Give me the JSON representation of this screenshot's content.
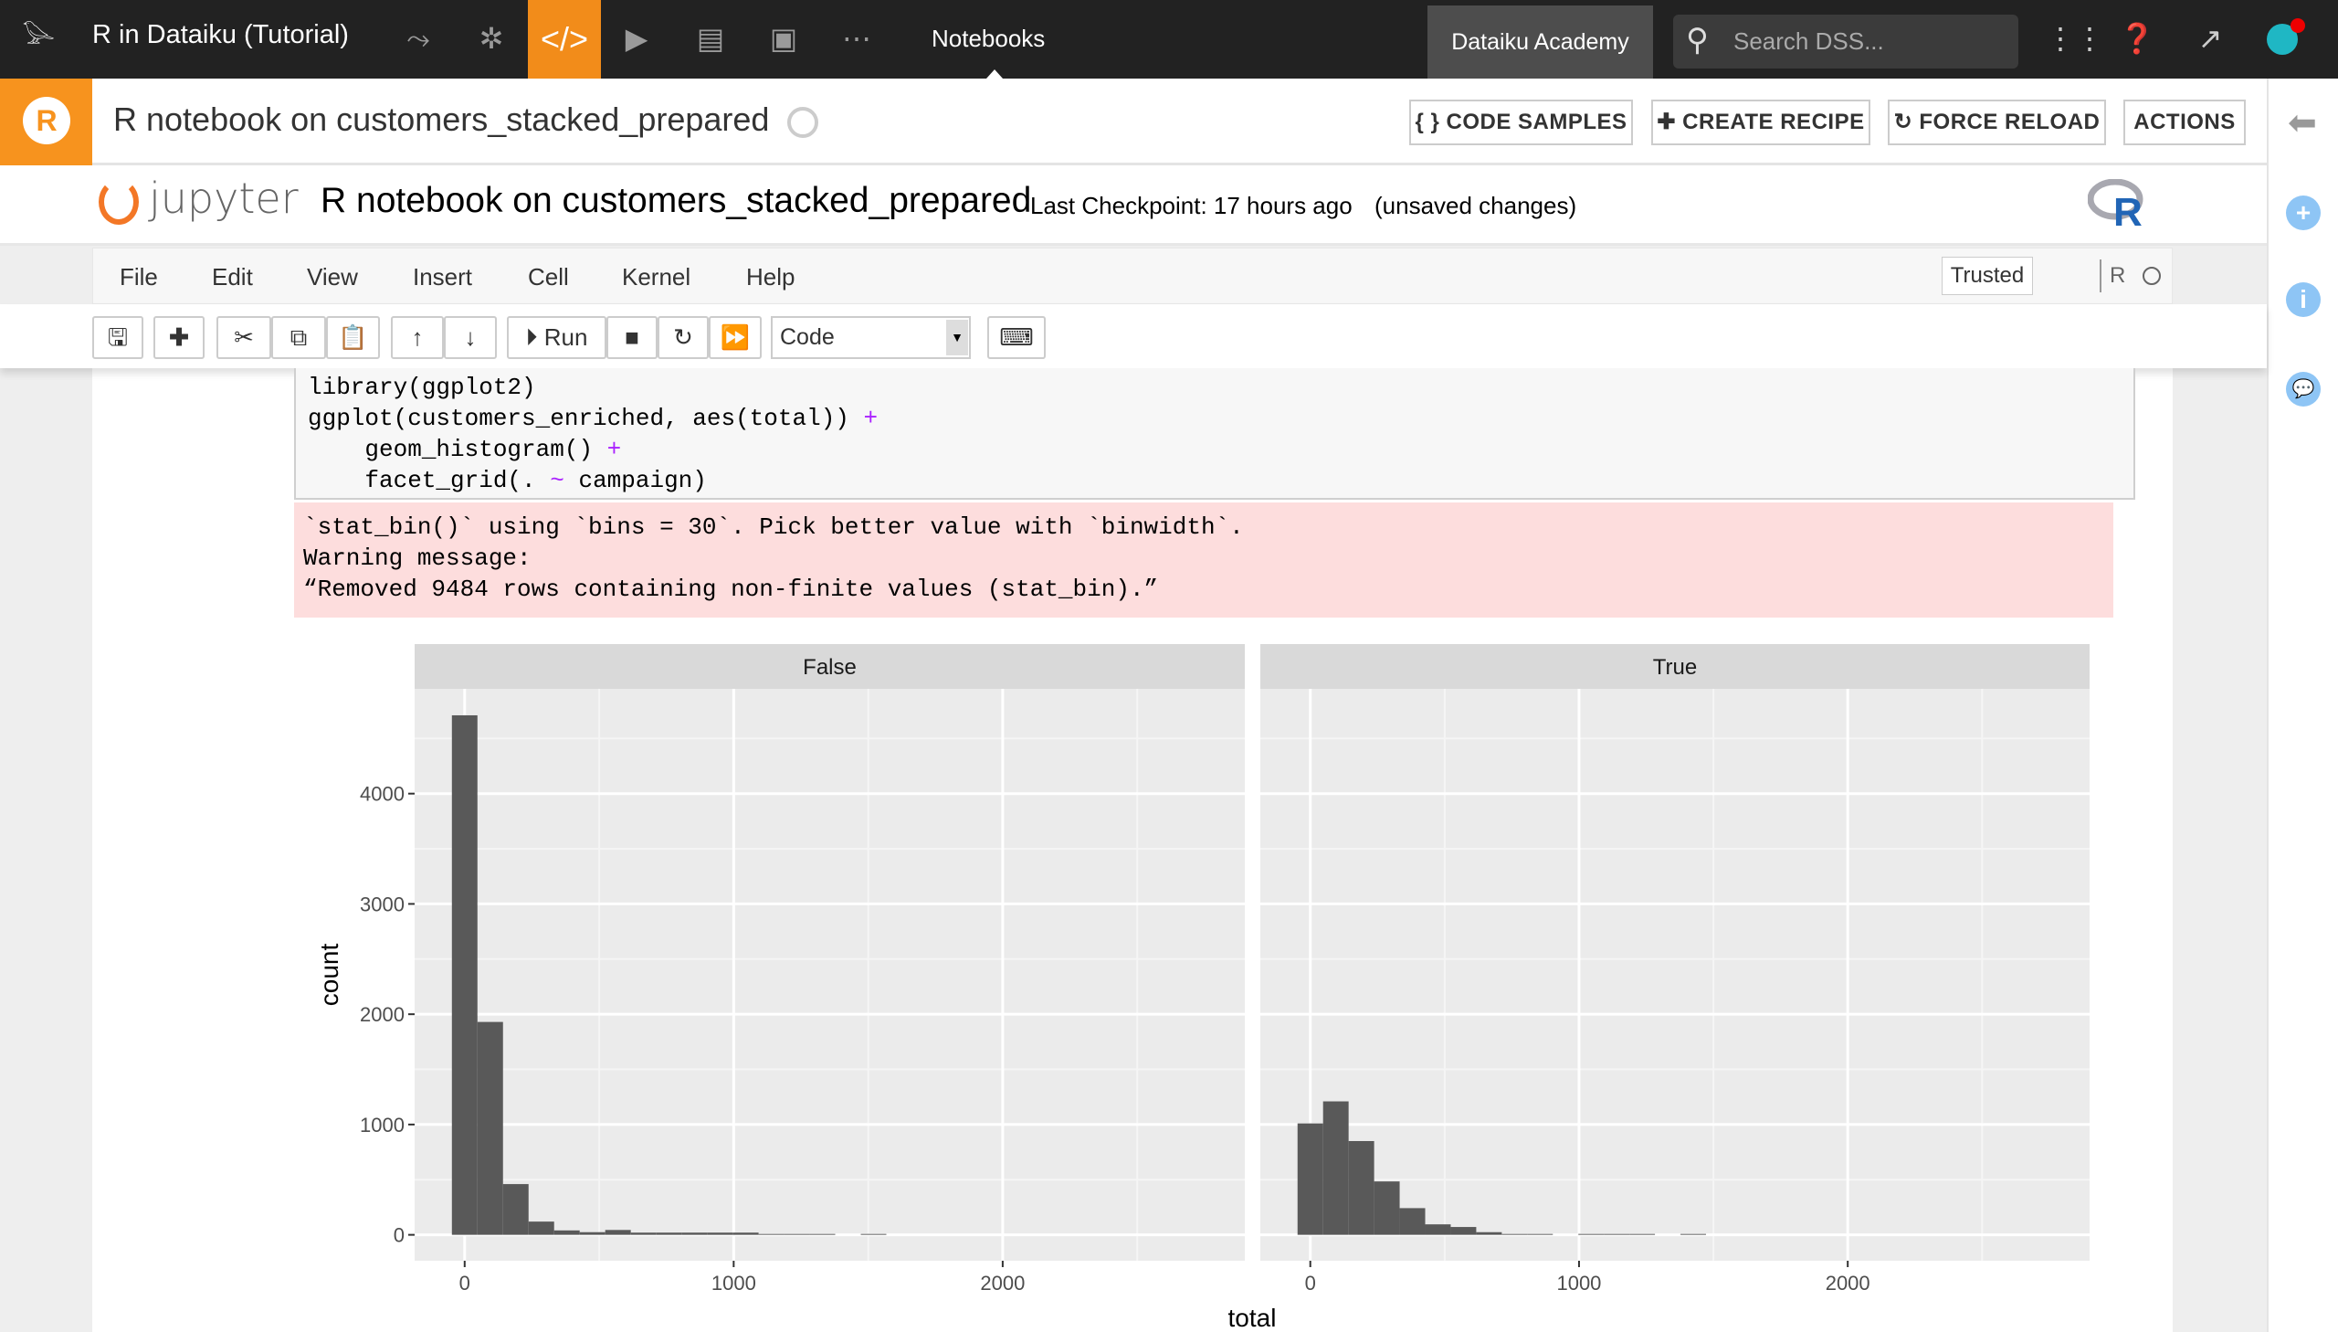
{
  "topbar": {
    "app_title": "R in Dataiku (Tutorial)",
    "icons": [
      "dataiku-bird-logo-icon",
      "flow-icon",
      "lab-icon",
      "code-icon",
      "run-icon",
      "deploy-icon",
      "dashboard-icon",
      "more-icon"
    ],
    "notebooks_label": "Notebooks",
    "academy_label": "Dataiku Academy",
    "search_placeholder": "Search DSS...",
    "right_icons": [
      "apps-grid-icon",
      "help-icon",
      "activity-icon",
      "avatar"
    ]
  },
  "header": {
    "title": "R notebook on customers_stacked_prepared",
    "buttons": {
      "code_samples": "{ }  CODE SAMPLES",
      "create_recipe": "✚ CREATE RECIPE",
      "force_reload": "↻ FORCE RELOAD",
      "actions": "ACTIONS"
    }
  },
  "jupyter": {
    "logo_text": "jupyter",
    "notebook_name": "R notebook on customers_stacked_prepared",
    "checkpoint": "Last Checkpoint: 17 hours ago",
    "unsaved": "(unsaved changes)",
    "kernel_logo": "R",
    "menu": [
      "File",
      "Edit",
      "View",
      "Insert",
      "Cell",
      "Kernel",
      "Help"
    ],
    "trusted": "Trusted",
    "kernel_name": "R",
    "toolbar": {
      "run_label": "Run",
      "cell_type": "Code"
    }
  },
  "cell": {
    "code_lines": [
      [
        {
          "t": "library(ggplot2)"
        }
      ],
      [
        {
          "t": "ggplot(customers_enriched, aes(total)) "
        },
        {
          "t": "+",
          "op": true
        }
      ],
      [
        {
          "t": "    geom_histogram() "
        },
        {
          "t": "+",
          "op": true
        }
      ],
      [
        {
          "t": "    facet_grid(. "
        },
        {
          "t": "~",
          "op": true
        },
        {
          "t": " campaign)"
        }
      ]
    ],
    "stderr_lines": [
      "`stat_bin()` using `bins = 30`. Pick better value with `binwidth`.",
      "Warning message:",
      "“Removed 9484 rows containing non-finite values (stat_bin).”"
    ]
  },
  "colors": {
    "brand_orange": "#f7931e",
    "bar": "#595959",
    "panel_bg": "#ebebeb",
    "strip_bg": "#d9d9d9",
    "stderr_bg": "#fddddd",
    "operator": "#aa22ff"
  },
  "chart_data": {
    "type": "bar",
    "subtype": "histogram-faceted",
    "xlabel": "total",
    "ylabel": "count",
    "xlim": [
      -186,
      2900
    ],
    "ylim": [
      -235,
      4950
    ],
    "x_ticks": [
      0,
      1000,
      2000
    ],
    "y_ticks": [
      0,
      1000,
      2000,
      3000,
      4000
    ],
    "grid": true,
    "bin_start": -47.5,
    "bin_width": 95,
    "facets": [
      {
        "name": "False",
        "values": [
          4710,
          1930,
          460,
          120,
          40,
          24,
          44,
          20,
          20,
          20,
          20,
          20,
          8,
          8,
          8,
          0,
          8
        ]
      },
      {
        "name": "True",
        "values": [
          1010,
          1210,
          850,
          484,
          242,
          95,
          71,
          24,
          8,
          8,
          0,
          8,
          8,
          8,
          0,
          8
        ]
      }
    ]
  }
}
